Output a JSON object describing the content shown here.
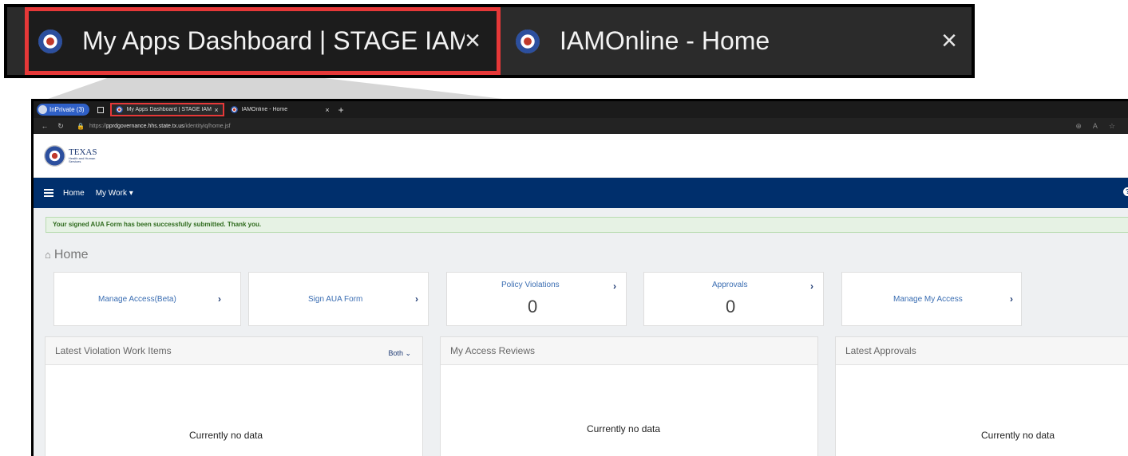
{
  "zoom": {
    "tabs": [
      {
        "title": "My Apps Dashboard | STAGE IAM",
        "close": "×",
        "active": true
      },
      {
        "title": "IAMOnline - Home",
        "close": "×",
        "active": false
      }
    ]
  },
  "browser": {
    "profile_label": "InPrivate (3)",
    "tabs": [
      {
        "title": "My Apps Dashboard | STAGE IAM",
        "close": "×"
      },
      {
        "title": "IAMOnline - Home",
        "close": "×"
      }
    ],
    "new_tab": "+",
    "url_host": "pprdgovernance.hhs.state.tx.us",
    "url_prefix": "https://",
    "url_path": "/identityiq/home.jsf"
  },
  "header": {
    "logo_line1": "TEXAS",
    "logo_line2": "Health and Human",
    "logo_line3": "Services"
  },
  "nav": {
    "home": "Home",
    "my_work": "My Work ▾",
    "help": "?"
  },
  "alert": "Your signed AUA Form has been successfully submitted. Thank you.",
  "page_title": "Home",
  "tiles": [
    {
      "label": "Manage Access(Beta)",
      "arrow": "›"
    },
    {
      "label": "Sign AUA Form",
      "arrow": "›"
    },
    {
      "label": "Policy Violations",
      "count": "0",
      "arrow": "›"
    },
    {
      "label": "Approvals",
      "count": "0",
      "arrow": "›"
    },
    {
      "label": "Manage My Access",
      "arrow": "›"
    }
  ],
  "panels": [
    {
      "title": "Latest Violation Work Items",
      "filter": "Both ⌄",
      "empty": "Currently no data"
    },
    {
      "title": "My Access Reviews",
      "empty": "Currently no data"
    },
    {
      "title": "Latest Approvals",
      "empty": "Currently no data"
    }
  ],
  "colors": {
    "highlight": "#e63838",
    "navbar": "#002f6c",
    "link": "#3a6db2",
    "alert_bg": "#e6f2e4"
  }
}
